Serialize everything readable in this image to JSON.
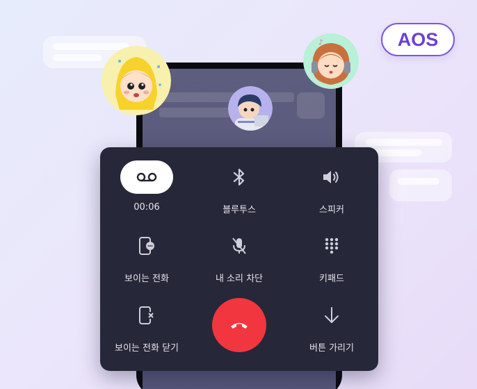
{
  "badge": {
    "label": "AOS",
    "color": "#6a40d8"
  },
  "call_controls": {
    "record": {
      "label": "00:06",
      "icon": "voicemail-icon"
    },
    "bluetooth": {
      "label": "블루투스",
      "icon": "bluetooth-icon"
    },
    "speaker": {
      "label": "스피커",
      "icon": "speaker-icon"
    },
    "visible_call": {
      "label": "보이는 전화",
      "icon": "phone-chat-icon"
    },
    "mute": {
      "label": "내 소리 차단",
      "icon": "mic-off-icon"
    },
    "keypad": {
      "label": "키패드",
      "icon": "keypad-icon"
    },
    "close_visible_call": {
      "label": "보이는 전화 닫기",
      "icon": "phone-close-icon"
    },
    "end_call": {
      "icon": "hangup-icon",
      "color": "#f2363f"
    },
    "hide_buttons": {
      "label": "버튼 가리기",
      "icon": "arrow-down-icon"
    }
  }
}
